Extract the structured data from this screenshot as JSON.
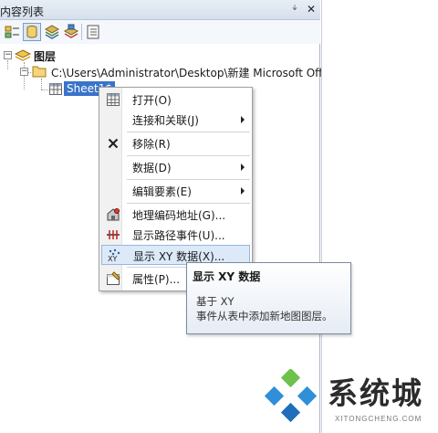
{
  "panel": {
    "title": "内容列表",
    "pin_glyph": "ᛎ",
    "close_glyph": "✕"
  },
  "toolbar": {
    "buttons": [
      {
        "icon": "list-by-drawing-order-icon"
      },
      {
        "icon": "list-by-source-icon",
        "active": true
      },
      {
        "icon": "list-by-visibility-icon"
      },
      {
        "icon": "list-by-selection-icon"
      },
      {
        "icon": "options-icon"
      }
    ]
  },
  "tree": {
    "layers_label": "图层",
    "folder_path": "C:\\Users\\Administrator\\Desktop\\新建 Microsoft Off",
    "sheet_label": "Sheet1$"
  },
  "context_menu": {
    "items": [
      {
        "label": "打开(O)",
        "icon": "table-icon"
      },
      {
        "label": "连接和关联(J)",
        "submenu": true
      },
      {
        "label": "移除(R)",
        "icon": "remove-x-icon"
      },
      {
        "label": "数据(D)",
        "submenu": true
      },
      {
        "label": "编辑要素(E)",
        "submenu": true
      },
      {
        "label": "地理编码地址(G)...",
        "icon": "geocode-icon"
      },
      {
        "label": "显示路径事件(U)...",
        "icon": "route-events-icon"
      },
      {
        "label": "显示 XY 数据(X)...",
        "icon": "xy-data-icon",
        "highlighted": true
      },
      {
        "label": "属性(P)...",
        "icon": "properties-icon"
      }
    ]
  },
  "tooltip": {
    "title": "显示 XY 数据",
    "body_line1": "基于 XY",
    "body_line2": "事件从表中添加新地图图层。"
  },
  "watermark": {
    "brand_cn": "系统城",
    "brand_en": "XITONGCHENG.COM"
  },
  "colors": {
    "selection": "#3a73c9",
    "menu_highlight": "#dce9f8",
    "panel_title_bg": "#dde6f1"
  }
}
